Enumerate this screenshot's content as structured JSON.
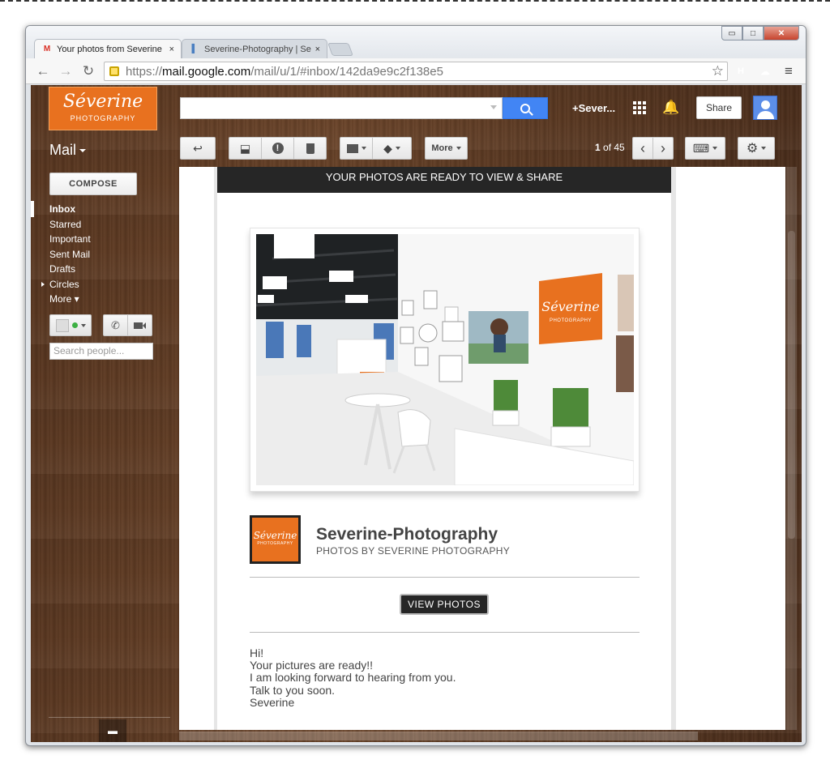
{
  "browser": {
    "tabs": [
      {
        "title": "Your photos from Severine",
        "close": "×",
        "favicon": "M"
      },
      {
        "title": "Severine-Photography | Se",
        "close": "×",
        "favicon": "▌"
      }
    ],
    "url_prefix": "https://",
    "url_domain": "mail.google.com",
    "url_path": "/mail/u/1/#inbox/142da9e9c2f138e5",
    "window_buttons": {
      "minimize": "▭",
      "maximize": "□",
      "close": "✕"
    },
    "nav": {
      "back": "←",
      "forward": "→",
      "reload": "↻",
      "star": "☆",
      "menu": "≡"
    },
    "extensions": [
      {
        "name": "H",
        "color": "#222222"
      },
      {
        "name": "☁",
        "color": "#3b82d6"
      }
    ]
  },
  "gmail": {
    "logo_script": "Séverine",
    "logo_sub": "PHOTOGRAPHY",
    "search_placeholder": "",
    "plus_user": "+Sever...",
    "share_label": "Share",
    "mail_label": "Mail",
    "toolbar": {
      "reply": "↩",
      "archive": "⬓",
      "spam": "!",
      "delete": "🗑",
      "move": "▬",
      "label": "◆",
      "more": "More",
      "count_prefix": "",
      "count_bold": "1",
      "count_suffix": " of 45",
      "prev": "‹",
      "next": "›",
      "keyboard": "⌨",
      "settings": "⚙"
    },
    "compose_label": "COMPOSE",
    "nav_items": [
      {
        "label": "Inbox",
        "active": true
      },
      {
        "label": "Starred"
      },
      {
        "label": "Important"
      },
      {
        "label": "Sent Mail"
      },
      {
        "label": "Drafts"
      },
      {
        "label": "Circles",
        "expandable": true
      },
      {
        "label": "More ▾"
      }
    ],
    "people_placeholder": "Search people...",
    "status_dot_color": "#3cb043"
  },
  "email": {
    "banner": "YOUR PHOTOS ARE READY TO VIEW & SHARE",
    "photo_sign_script": "Séverine",
    "photo_sign_sub": "PHOTOGRAPHY",
    "brand_logo_script": "Séverine",
    "brand_logo_sub": "PHOTOGRAPHY",
    "brand_name": "Severine-Photography",
    "brand_sub": "PHOTOS BY SEVERINE PHOTOGRAPHY",
    "button": "VIEW PHOTOS",
    "message_lines": [
      "Hi!",
      "Your pictures are ready!!",
      "I am looking forward to hearing from you.",
      "Talk to you soon.",
      "Severine"
    ],
    "accent_color": "#e8711f"
  }
}
